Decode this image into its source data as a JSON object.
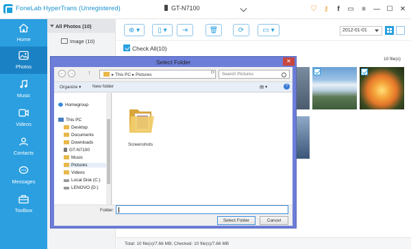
{
  "app": {
    "title": "FoneLab HyperTrans (Unregistered)",
    "device": "GT-N7100"
  },
  "window_controls": [
    "cart-icon",
    "key-icon",
    "facebook-icon",
    "feedback-icon",
    "menu-icon",
    "minimize-icon",
    "maximize-icon",
    "close-icon"
  ],
  "window_control_glyphs": [
    "⛉",
    "⚷",
    "f",
    "▭",
    "≡",
    "—",
    "☐",
    "✕"
  ],
  "sidebar": {
    "items": [
      {
        "label": "Home",
        "icon": "home-icon",
        "active": false
      },
      {
        "label": "Photos",
        "icon": "photos-icon",
        "active": true
      },
      {
        "label": "Music",
        "icon": "music-icon",
        "active": false
      },
      {
        "label": "Videos",
        "icon": "videos-icon",
        "active": false
      },
      {
        "label": "Contacts",
        "icon": "contacts-icon",
        "active": false
      },
      {
        "label": "Messages",
        "icon": "messages-icon",
        "active": false
      },
      {
        "label": "Toolbox",
        "icon": "toolbox-icon",
        "active": false
      }
    ]
  },
  "tree": {
    "header": "All Photos (10)",
    "items": [
      {
        "label": "Image (10)",
        "icon": "image-icon"
      }
    ]
  },
  "toolbar": {
    "buttons": [
      {
        "name": "add",
        "glyph": "⊕ ▾"
      },
      {
        "name": "export-device",
        "glyph": "▯ ▾"
      },
      {
        "name": "export-pc",
        "glyph": "⇥"
      },
      {
        "name": "delete",
        "glyph": "🗑"
      },
      {
        "name": "refresh",
        "glyph": "⟳"
      },
      {
        "name": "toolbox",
        "glyph": "▭ ▾"
      }
    ],
    "date": "2012-01-01"
  },
  "check_all_label": "Check All(10)",
  "file_count": "10 file(s)",
  "status": "Total: 10 file(s)/7.66 MB; Checked: 10 file(s)/7.66 MB",
  "dialog": {
    "title": "Select Folder",
    "close_glyph": "✕",
    "back_glyph": "←",
    "forward_glyph": "→",
    "up_glyph": "↑",
    "refresh_glyph": "⟳",
    "path": [
      "This PC",
      "Pictures"
    ],
    "path_sep": "▸",
    "search_placeholder": "Search Pictures",
    "organize": "Organize ▾",
    "new_folder": "New folder",
    "view_glyph": "▤ ▾",
    "help_glyph": "?",
    "nav_items": [
      {
        "label": "Homegroup",
        "icon": "homegroup-icon"
      },
      {
        "label": "This PC",
        "icon": "computer-icon"
      },
      {
        "label": "Desktop",
        "icon": "folder-icon"
      },
      {
        "label": "Documents",
        "icon": "folder-icon"
      },
      {
        "label": "Downloads",
        "icon": "folder-icon"
      },
      {
        "label": "GT-N7100",
        "icon": "phone-icon"
      },
      {
        "label": "Music",
        "icon": "folder-icon"
      },
      {
        "label": "Pictures",
        "icon": "folder-icon"
      },
      {
        "label": "Videos",
        "icon": "folder-icon"
      },
      {
        "label": "Local Disk (C:)",
        "icon": "drive-icon"
      },
      {
        "label": "LENOVO (D:)",
        "icon": "drive-icon"
      }
    ],
    "folders": [
      {
        "label": "Screenshots"
      }
    ],
    "folder_label": "Folder:",
    "folder_value": "",
    "select_button": "Select Folder",
    "cancel_button": "Cancel"
  },
  "colors": {
    "accent": "#2b9fe0",
    "sidebar_active": "#1a82c4",
    "dialog_frame": "#6d7ed9",
    "close_red": "#c9463d"
  }
}
